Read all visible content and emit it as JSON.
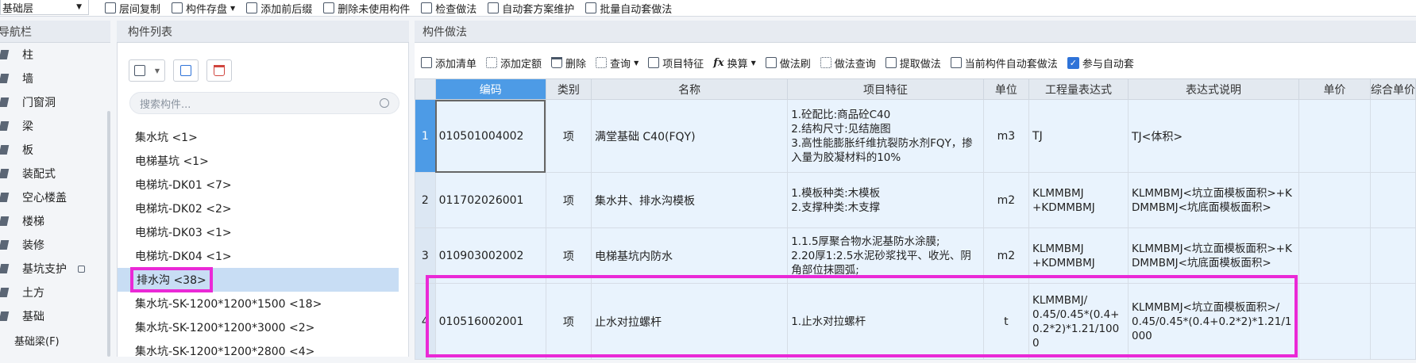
{
  "toolbar": {
    "layer_select": "基础层",
    "items": [
      "层间复制",
      "构件存盘",
      "添加前后缀",
      "删除未使用构件",
      "检查做法",
      "自动套方案维护",
      "批量自动套做法"
    ]
  },
  "nav": {
    "title": "导航栏",
    "items": [
      "柱",
      "墙",
      "门窗洞",
      "梁",
      "板",
      "装配式",
      "空心楼盖",
      "楼梯",
      "装修",
      "基坑支护",
      "土方",
      "基础",
      "基础梁(F)"
    ]
  },
  "list": {
    "title": "构件列表",
    "search_placeholder": "搜索构件...",
    "items": [
      "集水坑 <1>",
      "电梯基坑 <1>",
      "电梯坑-DK01 <7>",
      "电梯坑-DK02 <2>",
      "电梯坑-DK03 <1>",
      "电梯坑-DK04 <1>",
      "排水沟 <38>",
      "集水坑-SK-1200*1200*1500 <18>",
      "集水坑-SK-1200*1200*3000 <2>",
      "集水坑-SK-1200*1200*2800 <4>"
    ]
  },
  "method": {
    "title": "构件做法",
    "tools": [
      "添加清单",
      "添加定额",
      "删除",
      "查询",
      "项目特征",
      "换算",
      "做法刷",
      "做法查询",
      "提取做法",
      "当前构件自动套做法",
      "参与自动套"
    ],
    "columns": [
      "编码",
      "类别",
      "名称",
      "项目特征",
      "单位",
      "工程量表达式",
      "表达式说明",
      "单价",
      "综合单价"
    ],
    "rows": [
      {
        "no": "1",
        "code": "010501004002",
        "type": "项",
        "name": "满堂基础 C40(FQY)",
        "feature": "1.砼配比:商品砼C40\n2.结构尺寸:见结施图\n3.高性能膨胀纤维抗裂防水剂FQY，掺入量为胶凝材料的10%",
        "unit": "m3",
        "expr": "TJ",
        "desc": "TJ<体积>"
      },
      {
        "no": "2",
        "code": "011702026001",
        "type": "项",
        "name": "集水井、排水沟模板",
        "feature": "1.模板种类:木模板\n2.支撑种类:木支撑",
        "unit": "m2",
        "expr": "KLMMBMJ\n+KDMMBMJ",
        "desc": "KLMMBMJ<坑立面模板面积>+KDMMBMJ<坑底面模板面积>"
      },
      {
        "no": "3",
        "code": "010903002002",
        "type": "项",
        "name": "电梯基坑内防水",
        "feature": "1.1.5厚聚合物水泥基防水涂膜;\n2.20厚1:2.5水泥砂浆找平、收光、阴角部位抹圆弧;",
        "unit": "m2",
        "expr": "KLMMBMJ\n+KDMMBMJ",
        "desc": "KLMMBMJ<坑立面模板面积>+KDMMBMJ<坑底面模板面积>"
      },
      {
        "no": "4",
        "code": "010516002001",
        "type": "项",
        "name": "止水对拉螺杆",
        "feature": "1.止水对拉螺杆",
        "unit": "t",
        "expr": "KLMMBMJ/\n0.45/0.45*(0.4+0.2*2)*1.21/1000",
        "desc": "KLMMBMJ<坑立面模板面积>/\n0.45/0.45*(0.4+0.2*2)*1.21/1000"
      }
    ]
  }
}
